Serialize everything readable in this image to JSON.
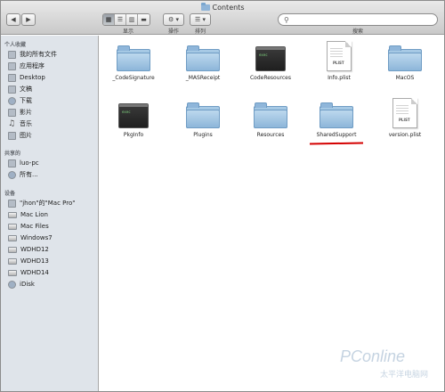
{
  "window": {
    "title": "Contents"
  },
  "toolbar": {
    "back_glyph": "◀",
    "forward_glyph": "▶",
    "view_modes": [
      "▦",
      "☰",
      "▥",
      "▬"
    ],
    "view_label": "显示",
    "action_glyph": "⚙ ▾",
    "action_label": "操作",
    "arrange_glyph": "☰ ▾",
    "arrange_label": "排列",
    "search_placeholder": "",
    "search_label": "搜索"
  },
  "sidebar": {
    "sections": [
      {
        "label": "个人收藏",
        "items": [
          {
            "label": "我的所有文件",
            "icon": "all-files-icon"
          },
          {
            "label": "应用程序",
            "icon": "applications-icon"
          },
          {
            "label": "Desktop",
            "icon": "desktop-icon"
          },
          {
            "label": "文稿",
            "icon": "documents-icon"
          },
          {
            "label": "下载",
            "icon": "downloads-icon"
          },
          {
            "label": "影片",
            "icon": "movies-icon"
          },
          {
            "label": "音乐",
            "icon": "music-icon"
          },
          {
            "label": "图片",
            "icon": "pictures-icon"
          }
        ]
      },
      {
        "label": "共享的",
        "items": [
          {
            "label": "luo-pc",
            "icon": "computer-icon"
          },
          {
            "label": "所有...",
            "icon": "network-icon"
          }
        ]
      },
      {
        "label": "设备",
        "items": [
          {
            "label": "\"jhon\"的\"Mac Pro\"",
            "icon": "computer-icon"
          },
          {
            "label": "Mac Lion",
            "icon": "disk-icon"
          },
          {
            "label": "Mac Files",
            "icon": "disk-icon"
          },
          {
            "label": "Windows7",
            "icon": "disk-icon"
          },
          {
            "label": "WDHD12",
            "icon": "disk-icon"
          },
          {
            "label": "WDHD13",
            "icon": "disk-icon"
          },
          {
            "label": "WDHD14",
            "icon": "disk-icon"
          },
          {
            "label": "iDisk",
            "icon": "idisk-icon"
          }
        ]
      }
    ]
  },
  "files": [
    {
      "name": "_CodeSignature",
      "kind": "folder"
    },
    {
      "name": "_MASReceipt",
      "kind": "folder"
    },
    {
      "name": "CodeResources",
      "kind": "exec"
    },
    {
      "name": "Info.plist",
      "kind": "plist",
      "tag": "PLIST"
    },
    {
      "name": "MacOS",
      "kind": "folder"
    },
    {
      "name": "PkgInfo",
      "kind": "exec"
    },
    {
      "name": "Plugins",
      "kind": "folder"
    },
    {
      "name": "Resources",
      "kind": "folder"
    },
    {
      "name": "SharedSupport",
      "kind": "folder"
    },
    {
      "name": "version.plist",
      "kind": "plist",
      "tag": "PLIST"
    }
  ],
  "exec_prompt": "exec",
  "watermark": {
    "brand": "PConline",
    "sub": "太平洋电脑网"
  },
  "colors": {
    "highlight_underline": "#d40000",
    "sidebar_bg": "#dfe4ea",
    "folder_blue": "#8db6d9"
  }
}
